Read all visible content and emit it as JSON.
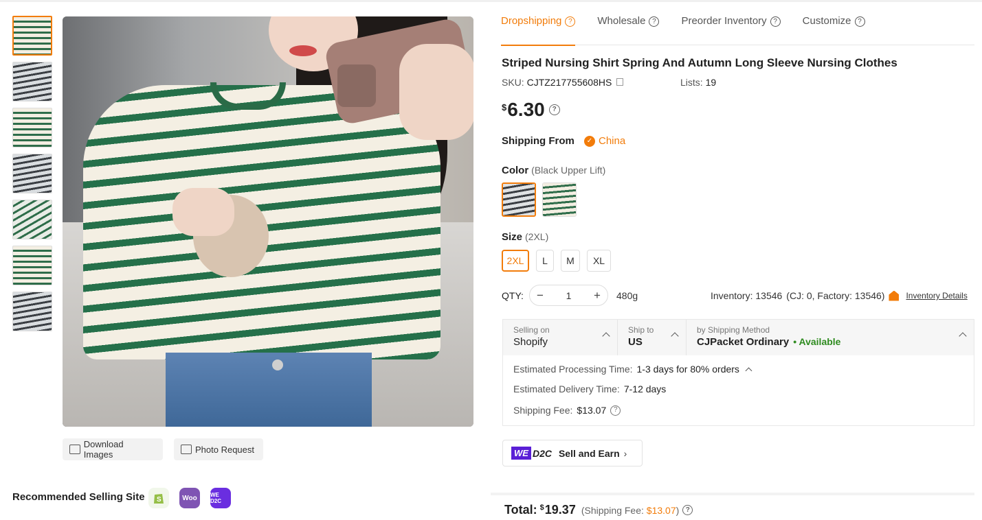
{
  "tabs": [
    {
      "label": "Dropshipping"
    },
    {
      "label": "Wholesale"
    },
    {
      "label": "Preorder Inventory"
    },
    {
      "label": "Customize"
    }
  ],
  "product": {
    "title": "Striped Nursing Shirt Spring And Autumn Long Sleeve Nursing Clothes",
    "sku_label": "SKU:",
    "sku": "CJTZ217755608HS",
    "lists_label": "Lists:",
    "lists": "19",
    "currency": "$",
    "price": "6.30"
  },
  "shipping_from": {
    "label": "Shipping From",
    "value": "China"
  },
  "color": {
    "label": "Color",
    "selected": "(Black Upper Lift)"
  },
  "size": {
    "label": "Size",
    "selected": "(2XL)",
    "options": [
      "2XL",
      "L",
      "M",
      "XL"
    ]
  },
  "qty": {
    "label": "QTY:",
    "value": "1",
    "weight": "480g"
  },
  "inventory": {
    "text": "Inventory: 13546",
    "detail": "(CJ: 0, Factory: 13546)",
    "link": "Inventory Details"
  },
  "ship_box": {
    "selling_on_label": "Selling on",
    "selling_on": "Shopify",
    "ship_to_label": "Ship to",
    "ship_to": "US",
    "method_label": "by Shipping Method",
    "method": "CJPacket Ordinary",
    "availability": "• Available",
    "processing_label": "Estimated Processing Time:",
    "processing": "1-3 days for 80% orders",
    "delivery_label": "Estimated Delivery Time:",
    "delivery": "7-12 days",
    "fee_label": "Shipping Fee:",
    "fee": "$13.07"
  },
  "promo": {
    "we": "WE",
    "d2c": "D2C",
    "text": "Sell and Earn"
  },
  "total": {
    "label": "Total:",
    "currency": "$",
    "amount": "19.37",
    "fee_prefix": "(Shipping Fee: ",
    "fee": "$13.07",
    "fee_suffix": ")"
  },
  "image_actions": {
    "download": "Download Images",
    "photo": "Photo Request"
  },
  "recommended": {
    "label": "Recommended Selling Site",
    "sites": [
      "shopify-icon",
      "woo-icon",
      "we-d2c-icon"
    ],
    "woo_text": "Woo",
    "wed2c_text": "WE D2C"
  },
  "colors": {
    "accent": "#f27c0a",
    "available": "#2e8b1f",
    "we_purple": "#5a1fd6"
  }
}
